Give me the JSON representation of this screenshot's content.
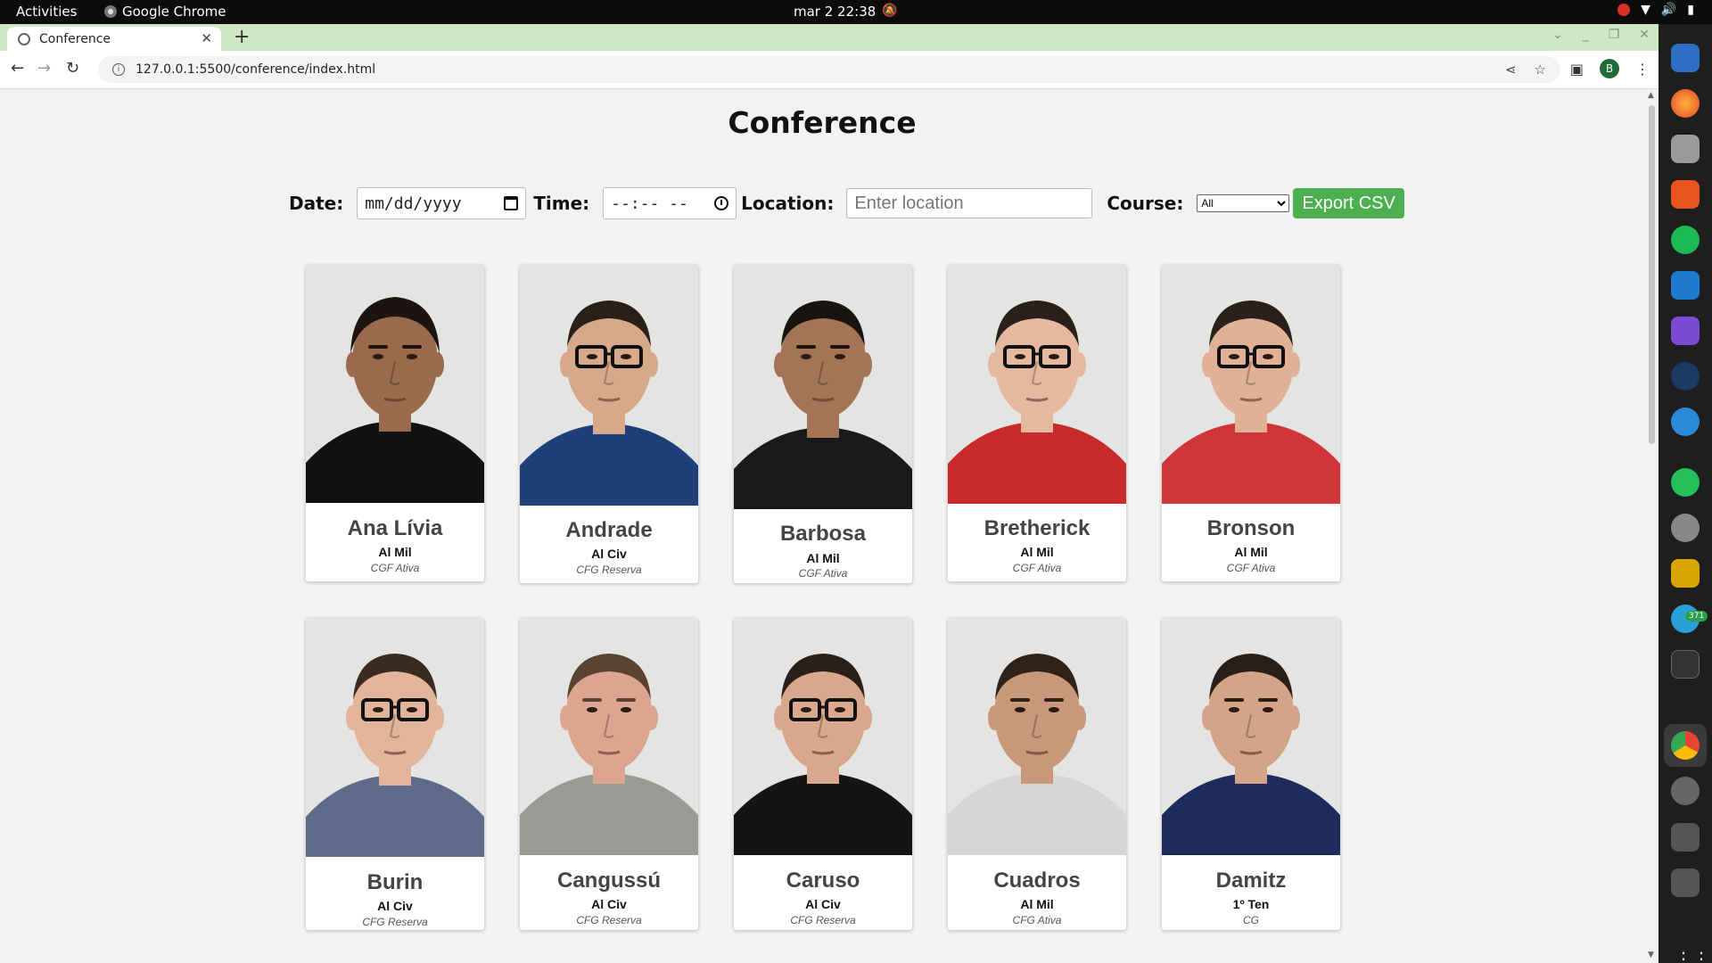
{
  "os": {
    "activities": "Activities",
    "app_name": "Google Chrome",
    "clock": "mar 2  22:38"
  },
  "browser": {
    "tab_title": "Conference",
    "url": "127.0.0.1:5500/conference/index.html",
    "profile_initial": "B"
  },
  "page": {
    "title": "Conference",
    "controls": {
      "date_label": "Date:",
      "date_value": "mm/dd/yyyy",
      "time_label": "Time:",
      "time_value": "--:-- --",
      "location_label": "Location:",
      "location_placeholder": "Enter location",
      "course_label": "Course:",
      "course_selected": "All",
      "export_label": "Export CSV"
    }
  },
  "dock": {
    "telegram_badge": "371"
  },
  "colors": {
    "accent_green": "#4caf50",
    "tabstrip": "#cde8c2"
  },
  "people": [
    {
      "name": "Ana Lívia",
      "rank": "Al Mil",
      "course": "CGF Ativa",
      "skin": "#9a6a4c",
      "hair": "#1c1410",
      "shirt": "#111111",
      "glasses": false,
      "female": true
    },
    {
      "name": "Andrade",
      "rank": "Al Civ",
      "course": "CFG Reserva",
      "skin": "#d7a98b",
      "hair": "#2b2019",
      "shirt": "#1f3f78",
      "glasses": true,
      "female": false
    },
    {
      "name": "Barbosa",
      "rank": "Al Mil",
      "course": "CGF Ativa",
      "skin": "#a47457",
      "hair": "#1a1410",
      "shirt": "#1a1a1a",
      "glasses": false,
      "female": false
    },
    {
      "name": "Bretherick",
      "rank": "Al Mil",
      "course": "CGF Ativa",
      "skin": "#e4b9a0",
      "hair": "#2a1f1a",
      "shirt": "#c92a2a",
      "glasses": true,
      "female": false
    },
    {
      "name": "Bronson",
      "rank": "Al Mil",
      "course": "CGF Ativa",
      "skin": "#e0b197",
      "hair": "#2a1f1a",
      "shirt": "#d0353a",
      "glasses": true,
      "female": false
    },
    {
      "name": "Burin",
      "rank": "Al Civ",
      "course": "CFG Reserva",
      "skin": "#e2b49a",
      "hair": "#3a2a20",
      "shirt": "#5e6a8a",
      "glasses": true,
      "female": false
    },
    {
      "name": "Cangussú",
      "rank": "Al Civ",
      "course": "CFG Reserva",
      "skin": "#dba58f",
      "hair": "#5b4333",
      "shirt": "#9a9a94",
      "glasses": false,
      "female": false
    },
    {
      "name": "Caruso",
      "rank": "Al Civ",
      "course": "CFG Reserva",
      "skin": "#d9a88c",
      "hair": "#2a1f19",
      "shirt": "#141414",
      "glasses": true,
      "female": false
    },
    {
      "name": "Cuadros",
      "rank": "Al Mil",
      "course": "CFG Ativa",
      "skin": "#c9987b",
      "hair": "#2e2219",
      "shirt": "#d6d6d6",
      "glasses": false,
      "female": false
    },
    {
      "name": "Damitz",
      "rank": "1º Ten",
      "course": "CG",
      "skin": "#d3a488",
      "hair": "#2a1f18",
      "shirt": "#1d2c5c",
      "glasses": false,
      "female": false
    }
  ]
}
